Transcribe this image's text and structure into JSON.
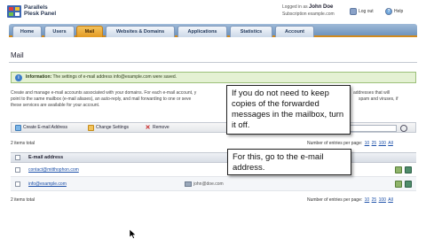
{
  "header": {
    "brand_line1": "Parallels",
    "brand_line2": "Plesk Panel",
    "logged_in_label": "Logged in as",
    "user_name": "John Doe",
    "subscription_label": "Subscription",
    "subscription_value": "example.com",
    "logout_label": "Log out",
    "help_label": "Help"
  },
  "tabs": [
    {
      "label": "Home"
    },
    {
      "label": "Users"
    },
    {
      "label": "Mail"
    },
    {
      "label": "Websites & Domains"
    },
    {
      "label": "Applications"
    },
    {
      "label": "Statistics"
    },
    {
      "label": "Account"
    }
  ],
  "page": {
    "title": "Mail"
  },
  "info": {
    "label": "Information:",
    "message": "The settings of e-mail address info@example.com were saved."
  },
  "description": {
    "left_text": "Create and manage e-mail accounts associated with your domains. For each e-mail account, y",
    "right_text": "addresses that will",
    "line2_left": "point to the same mailbox (e-mail aliases), an auto-reply, and mail forwarding to one or seve",
    "line2_right": "spam and viruses, if",
    "line3_left": "these services are available for your account."
  },
  "toolbar": {
    "create_label": "Create E-mail Address",
    "change_label": "Change Settings",
    "remove_label": "Remove"
  },
  "list": {
    "items_total_top": "2 items total",
    "items_total_bottom": "2 items total",
    "per_page_label": "Number of entries per page:",
    "per_page_options": [
      "10",
      "25",
      "100",
      "All"
    ],
    "column_header": "E-mail address",
    "rows": [
      {
        "address": "contact@mitthophon.com",
        "forward": ""
      },
      {
        "address": "info@example.com",
        "forward": "john@doe.com"
      }
    ]
  },
  "tooltips": {
    "first": "If you do not need to keep copies of the forwarded messages in the mailbox, turn it off.",
    "second": "For this, go to the e-mail address."
  }
}
